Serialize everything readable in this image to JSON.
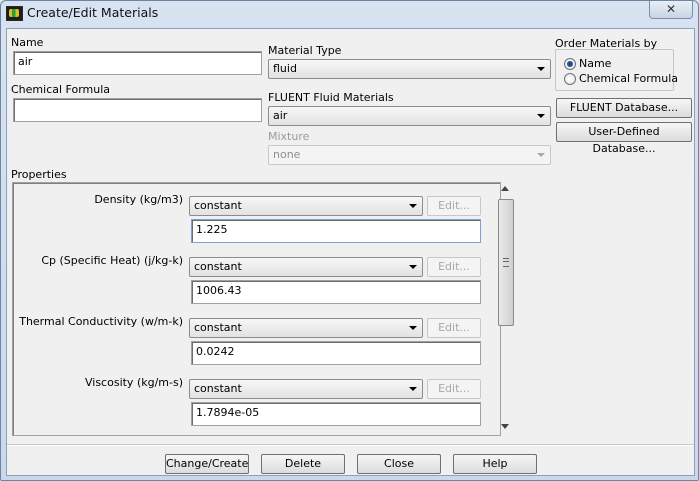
{
  "window": {
    "title": "Create/Edit Materials",
    "close_glyph": "✕"
  },
  "name_field": {
    "label": "Name",
    "value": "air"
  },
  "formula_field": {
    "label": "Chemical Formula",
    "value": ""
  },
  "material_type": {
    "label": "Material Type",
    "value": "fluid"
  },
  "fluent_materials": {
    "label": "FLUENT Fluid Materials",
    "value": "air"
  },
  "mixture": {
    "label": "Mixture",
    "value": "none"
  },
  "order_by": {
    "label": "Order Materials by",
    "options": [
      {
        "label": "Name",
        "selected": true
      },
      {
        "label": "Chemical Formula",
        "selected": false
      }
    ]
  },
  "side_buttons": {
    "fluent_db": "FLUENT Database...",
    "user_db": "User-Defined Database..."
  },
  "properties": {
    "label": "Properties",
    "items": [
      {
        "label": "Density (kg/m3)",
        "method": "constant",
        "edit": "Edit...",
        "value": "1.225"
      },
      {
        "label": "Cp (Specific Heat) (j/kg-k)",
        "method": "constant",
        "edit": "Edit...",
        "value": "1006.43"
      },
      {
        "label": "Thermal Conductivity (w/m-k)",
        "method": "constant",
        "edit": "Edit...",
        "value": "0.0242"
      },
      {
        "label": "Viscosity (kg/m-s)",
        "method": "constant",
        "edit": "Edit...",
        "value": "1.7894e-05"
      }
    ]
  },
  "footer": {
    "change_create": "Change/Create",
    "delete": "Delete",
    "close": "Close",
    "help": "Help"
  }
}
